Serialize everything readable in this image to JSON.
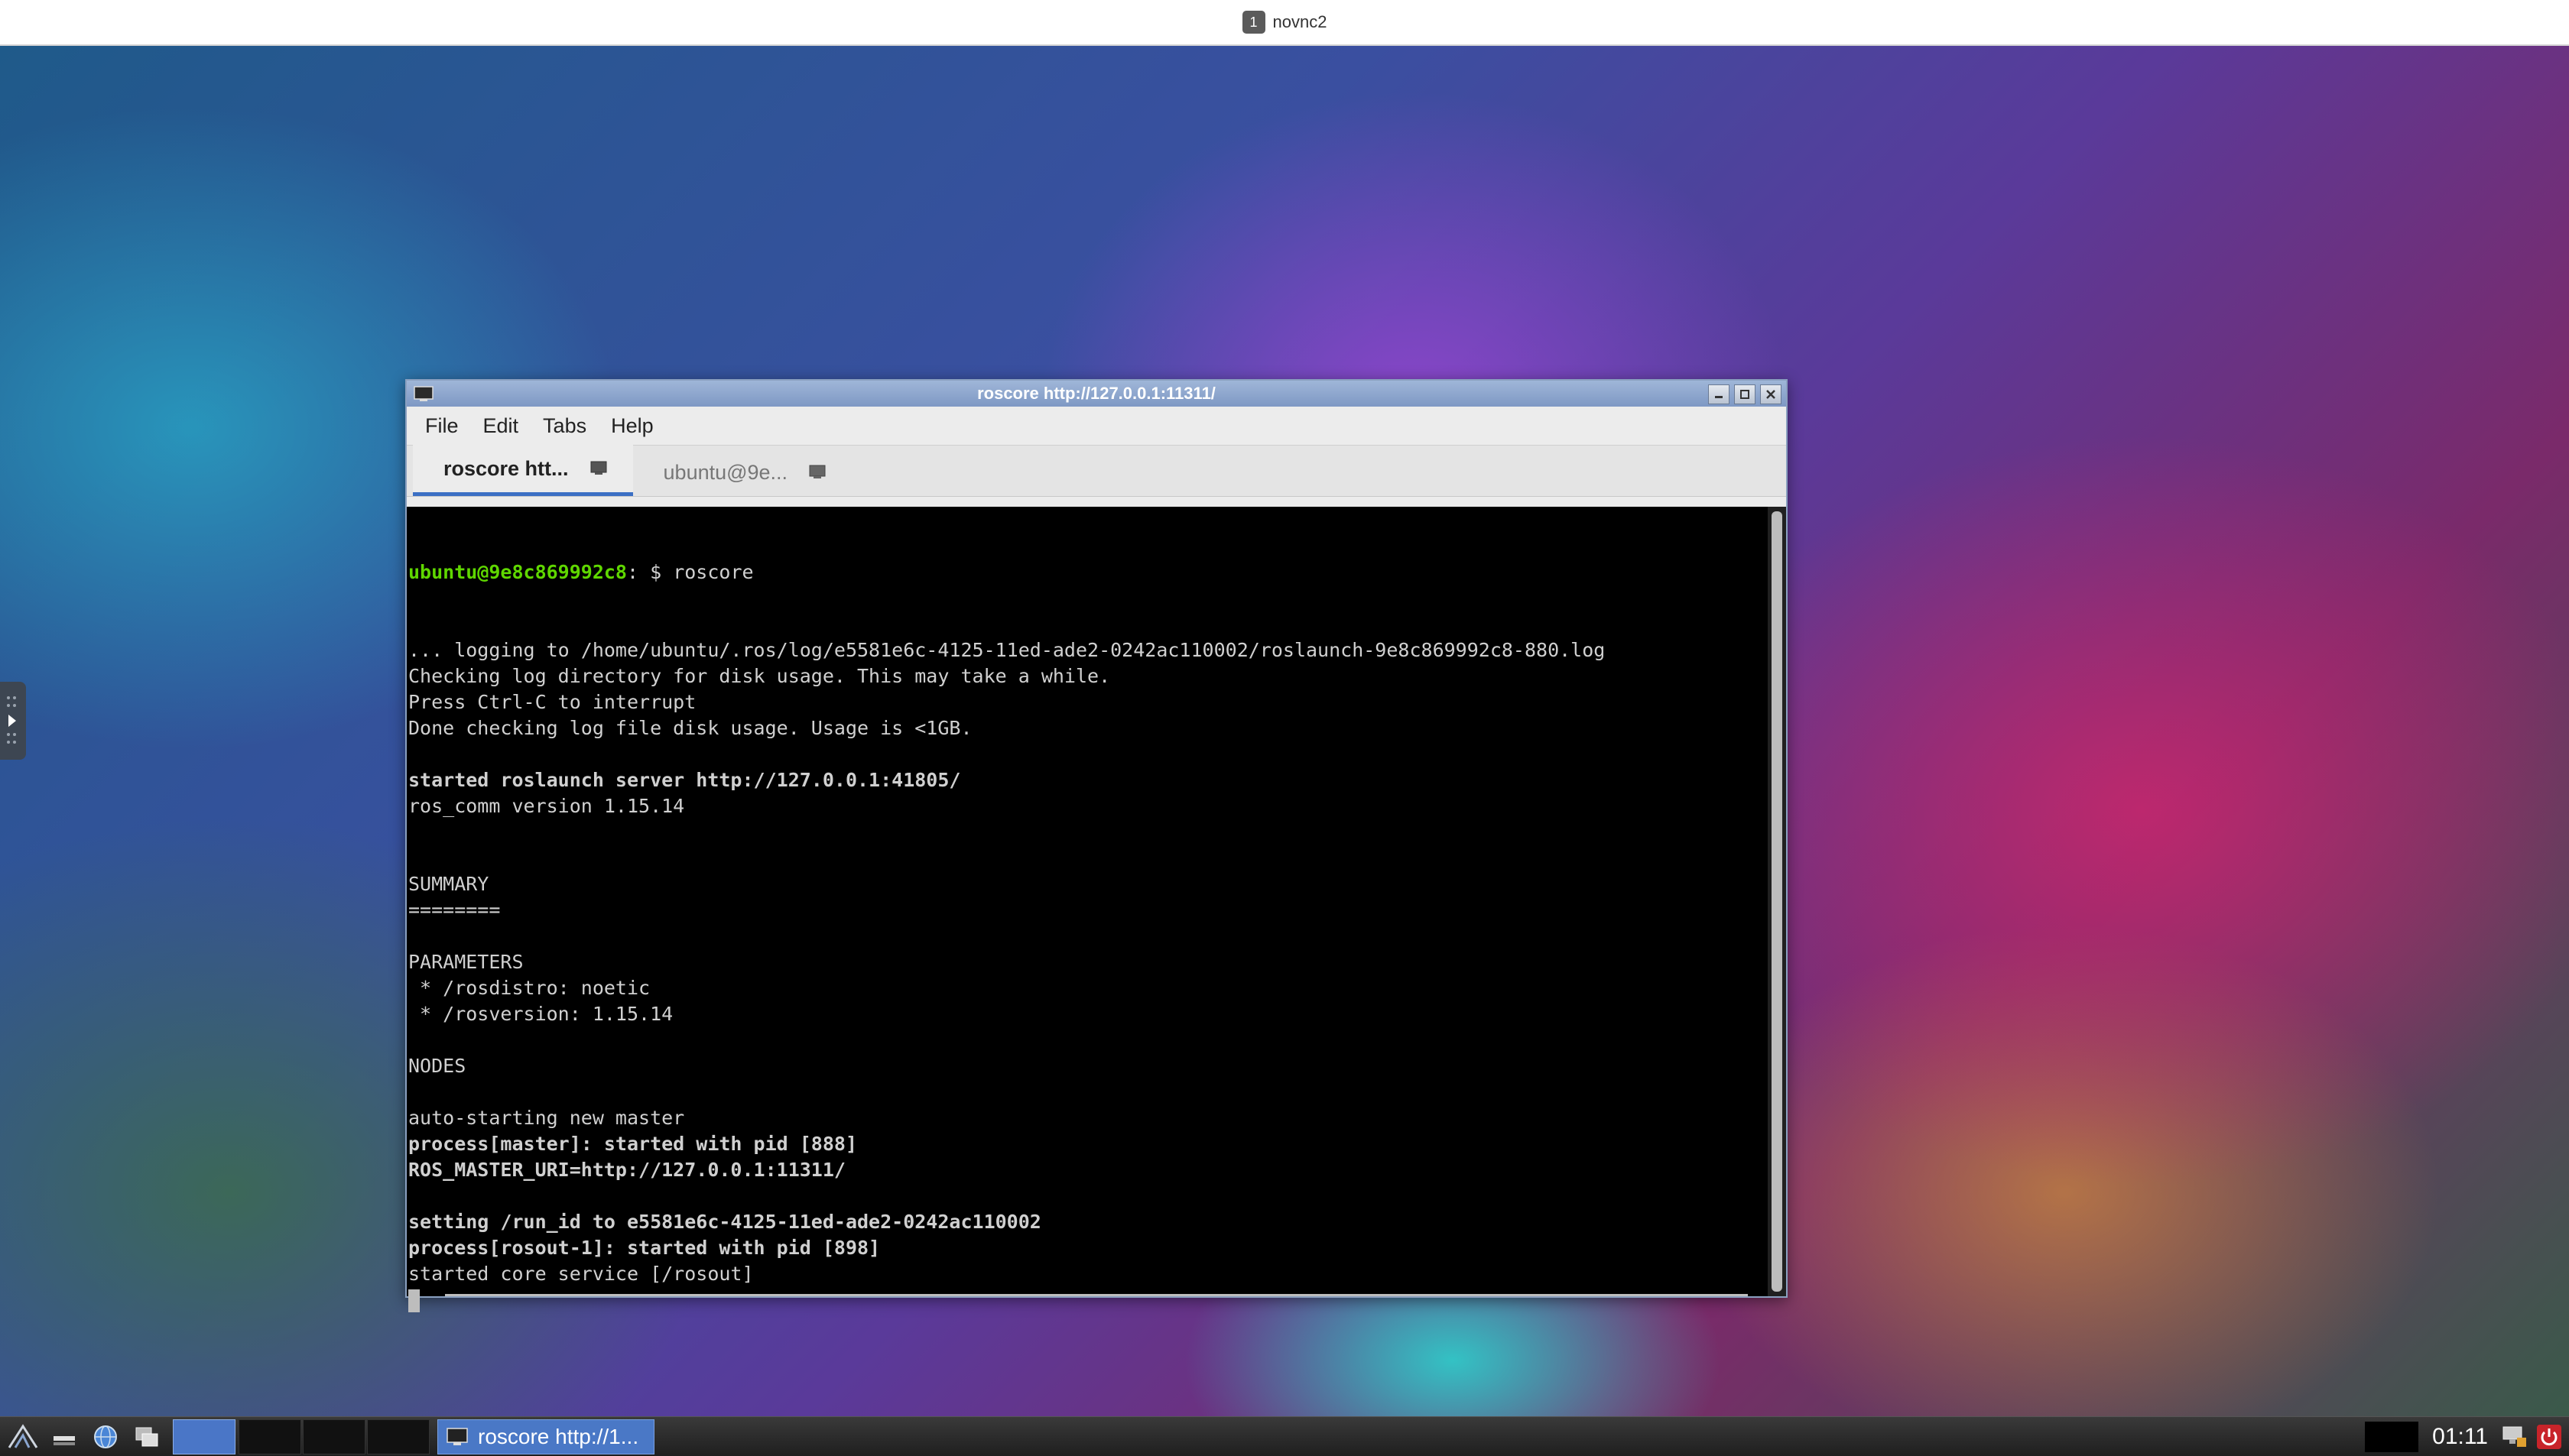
{
  "topbar": {
    "workspace_number": "1",
    "title": "novnc2"
  },
  "window": {
    "title": "roscore http://127.0.0.1:11311/",
    "menu": [
      "File",
      "Edit",
      "Tabs",
      "Help"
    ],
    "tabs": [
      {
        "label": "roscore htt...",
        "active": true
      },
      {
        "label": "ubuntu@9e...",
        "active": false
      }
    ]
  },
  "terminal": {
    "prompt_user": "ubuntu@9e8c869992c8",
    "prompt_rest": ": $ roscore",
    "lines": [
      {
        "text": "... logging to /home/ubuntu/.ros/log/e5581e6c-4125-11ed-ade2-0242ac110002/roslaunch-9e8c869992c8-880.log",
        "bold": false
      },
      {
        "text": "Checking log directory for disk usage. This may take a while.",
        "bold": false
      },
      {
        "text": "Press Ctrl-C to interrupt",
        "bold": false
      },
      {
        "text": "Done checking log file disk usage. Usage is <1GB.",
        "bold": false
      },
      {
        "text": "",
        "bold": false
      },
      {
        "text": "started roslaunch server http://127.0.0.1:41805/",
        "bold": true
      },
      {
        "text": "ros_comm version 1.15.14",
        "bold": false
      },
      {
        "text": "",
        "bold": false
      },
      {
        "text": "",
        "bold": false
      },
      {
        "text": "SUMMARY",
        "bold": false
      },
      {
        "text": "========",
        "bold": false
      },
      {
        "text": "",
        "bold": false
      },
      {
        "text": "PARAMETERS",
        "bold": false
      },
      {
        "text": " * /rosdistro: noetic",
        "bold": false
      },
      {
        "text": " * /rosversion: 1.15.14",
        "bold": false
      },
      {
        "text": "",
        "bold": false
      },
      {
        "text": "NODES",
        "bold": false
      },
      {
        "text": "",
        "bold": false
      },
      {
        "text": "auto-starting new master",
        "bold": false
      },
      {
        "text": "process[master]: started with pid [888]",
        "bold": true
      },
      {
        "text": "ROS_MASTER_URI=http://127.0.0.1:11311/",
        "bold": true
      },
      {
        "text": "",
        "bold": false
      },
      {
        "text": "setting /run_id to e5581e6c-4125-11ed-ade2-0242ac110002",
        "bold": true
      },
      {
        "text": "process[rosout-1]: started with pid [898]",
        "bold": true
      },
      {
        "text": "started core service [/rosout]",
        "bold": false
      }
    ]
  },
  "taskbar": {
    "task_label": "roscore http://1...",
    "clock": "01:11"
  },
  "icons": {
    "launcher": "lxde-logo-icon",
    "minimize_all": "show-desktop-icon",
    "browser": "globe-icon",
    "file_manager": "windows-icon",
    "terminal": "terminal-icon",
    "network": "network-icon",
    "power": "power-icon"
  }
}
